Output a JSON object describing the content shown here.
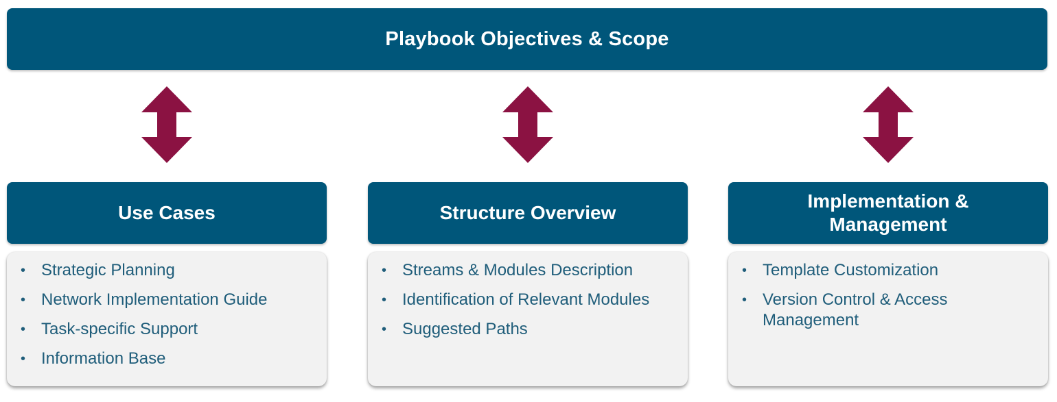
{
  "header": {
    "title": "Playbook Objectives & Scope"
  },
  "colors": {
    "header_fill": "#00567a",
    "arrow_fill": "#8b1242",
    "box_fill": "#f2f2f2",
    "bullet_text": "#1f5d7a"
  },
  "columns": [
    {
      "title": "Use Cases",
      "items": [
        "Strategic Planning",
        "Network Implementation Guide",
        "Task-specific Support",
        "Information Base"
      ]
    },
    {
      "title": "Structure Overview",
      "items": [
        "Streams & Modules Description",
        "Identification of Relevant Modules",
        "Suggested Paths"
      ]
    },
    {
      "title": "Implementation &\nManagement",
      "items": [
        "Template Customization",
        "Version Control & Access Management"
      ]
    }
  ],
  "bullet_glyph": "•",
  "arrow_icon": "double-headed-vertical-arrow"
}
